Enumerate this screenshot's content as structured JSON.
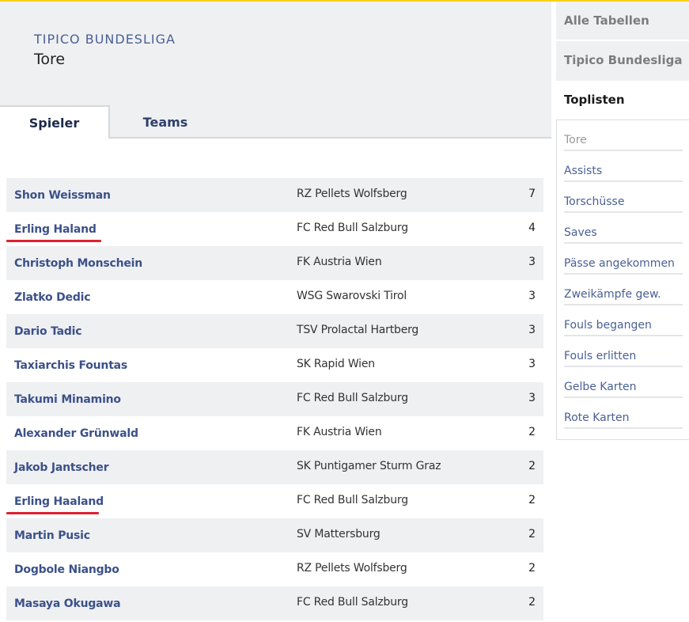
{
  "colors": {
    "accent": "#f7d117",
    "link": "#3c5189",
    "highlight_underline": "#e02030",
    "row_alt": "#eff0f2"
  },
  "header": {
    "league": "TIPICO BUNDESLIGA",
    "title": "Tore"
  },
  "tabs": [
    {
      "label": "Spieler",
      "active": true
    },
    {
      "label": "Teams",
      "active": false
    }
  ],
  "table": {
    "rows": [
      {
        "player": "Shon Weissman",
        "team": "RZ Pellets Wolfsberg",
        "goals": "7"
      },
      {
        "player": "Erling Haland",
        "team": "FC Red Bull Salzburg",
        "goals": "4",
        "underlined": true
      },
      {
        "player": "Christoph Monschein",
        "team": "FK Austria Wien",
        "goals": "3"
      },
      {
        "player": "Zlatko Dedic",
        "team": "WSG Swarovski Tirol",
        "goals": "3"
      },
      {
        "player": "Dario Tadic",
        "team": "TSV Prolactal Hartberg",
        "goals": "3"
      },
      {
        "player": "Taxiarchis Fountas",
        "team": "SK Rapid Wien",
        "goals": "3"
      },
      {
        "player": "Takumi Minamino",
        "team": "FC Red Bull Salzburg",
        "goals": "3"
      },
      {
        "player": "Alexander Grünwald",
        "team": "FK Austria Wien",
        "goals": "2"
      },
      {
        "player": "Jakob Jantscher",
        "team": "SK Puntigamer Sturm Graz",
        "goals": "2"
      },
      {
        "player": "Erling Haaland",
        "team": "FC Red Bull Salzburg",
        "goals": "2",
        "underlined": true
      },
      {
        "player": "Martin Pusic",
        "team": "SV Mattersburg",
        "goals": "2"
      },
      {
        "player": "Dogbole Niangbo",
        "team": "RZ Pellets Wolfsberg",
        "goals": "2"
      },
      {
        "player": "Masaya Okugawa",
        "team": "FC Red Bull Salzburg",
        "goals": "2"
      }
    ]
  },
  "sidebar": {
    "all_tables": "Alle Tabellen",
    "league": "Tipico Bundesliga",
    "toplists": "Toplisten",
    "items": [
      {
        "label": "Tore",
        "current": true
      },
      {
        "label": "Assists"
      },
      {
        "label": "Torschüsse"
      },
      {
        "label": "Saves"
      },
      {
        "label": "Pässe angekommen"
      },
      {
        "label": "Zweikämpfe gew."
      },
      {
        "label": "Fouls begangen"
      },
      {
        "label": "Fouls erlitten"
      },
      {
        "label": "Gelbe Karten"
      },
      {
        "label": "Rote Karten"
      }
    ]
  }
}
